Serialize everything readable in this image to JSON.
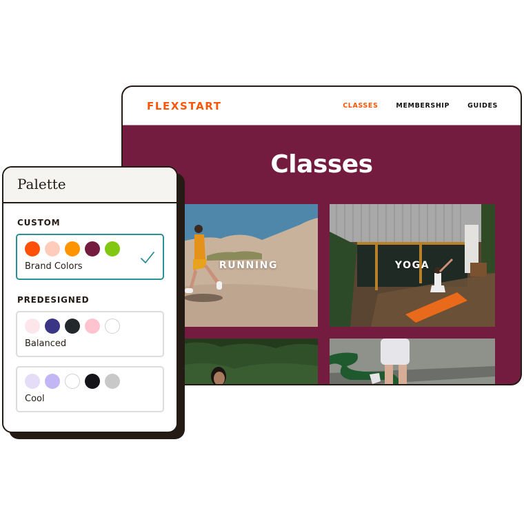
{
  "site": {
    "logo": "FLEXSTART",
    "nav": [
      {
        "label": "CLASSES",
        "active": true
      },
      {
        "label": "MEMBERSHIP",
        "active": false
      },
      {
        "label": "GUIDES",
        "active": false
      }
    ],
    "hero_title": "Classes",
    "cards": [
      {
        "label": "RUNNING",
        "image": "runner-in-desert-photo"
      },
      {
        "label": "YOGA",
        "image": "yoga-on-deck-photo"
      },
      {
        "label": "",
        "image": "person-in-greenery-photo"
      },
      {
        "label": "",
        "image": "legs-and-resistance-band-photo"
      }
    ],
    "colors": {
      "brand": "#fb5607",
      "background": "#741c40"
    }
  },
  "palette": {
    "title": "Palette",
    "custom_label": "CUSTOM",
    "predesigned_label": "PREDESIGNED",
    "options": [
      {
        "name": "Brand Colors",
        "selected": true,
        "swatches": [
          "#fd5108",
          "#ffcbba",
          "#fd9500",
          "#741c40",
          "#82c812"
        ]
      },
      {
        "name": "Balanced",
        "selected": false,
        "swatches": [
          "#fde5ec",
          "#3b3585",
          "#22282b",
          "#ffc3d0",
          "#ffffff"
        ]
      },
      {
        "name": "Cool",
        "selected": false,
        "swatches": [
          "#e5dcf8",
          "#c2b6f4",
          "#ffffff",
          "#151418",
          "#c8c8c8"
        ]
      }
    ]
  }
}
